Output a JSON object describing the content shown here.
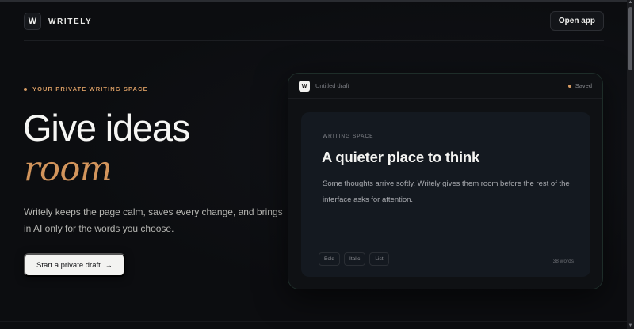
{
  "header": {
    "logo_mark": "W",
    "brand": "WRITELY",
    "open_app_label": "Open app"
  },
  "hero": {
    "eyebrow": "YOUR PRIVATE WRITING SPACE",
    "title_line1": "Give ideas",
    "title_line2": "room",
    "lede": "Writely keeps the page calm, saves every change, and brings in AI only for the words you choose.",
    "cta_label": "Start a private draft",
    "cta_arrow": "→"
  },
  "editor": {
    "logo_mark": "W",
    "doc_name": "Untitled draft",
    "status": "Saved",
    "section_label": "WRITING SPACE",
    "title": "A quieter place to think",
    "body": "Some thoughts arrive softly. Writely gives them room before the rest of the interface asks for attention.",
    "tools": [
      "Bold",
      "Italic",
      "List"
    ],
    "word_count": "38 words"
  },
  "colors": {
    "background": "#0c0d10",
    "accent": "#d59a62",
    "text": "#f2f2f0",
    "muted": "#b6b6b2"
  }
}
